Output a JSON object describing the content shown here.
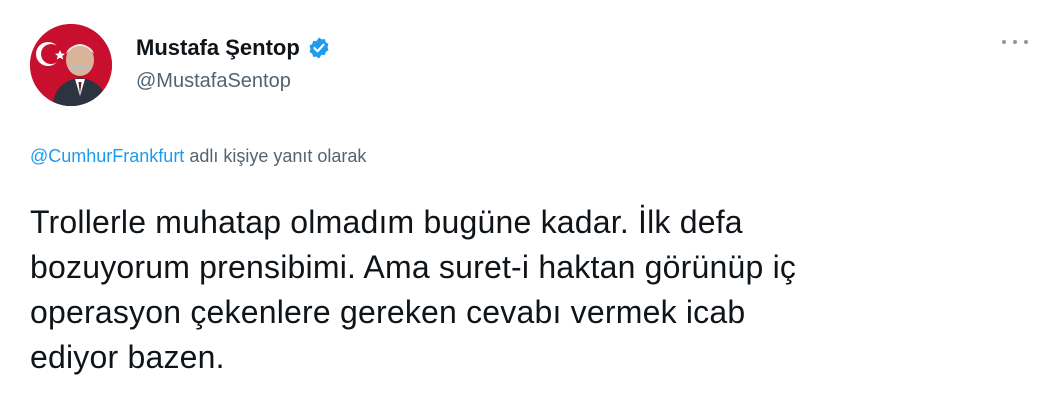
{
  "tweet": {
    "author": {
      "display_name": "Mustafa Şentop",
      "handle": "@MustafaSentop",
      "verified": true,
      "avatar_icon": "profile-avatar"
    },
    "reply": {
      "to_handle": "@CumhurFrankfurt",
      "suffix": " adlı kişiye yanıt olarak"
    },
    "text_lines": [
      "Trollerle muhatap olmadım bugüne kadar. İlk defa",
      "bozuyorum prensibimi. Ama suret-i haktan görünüp iç",
      "operasyon çekenlere gereken cevabı vermek icab",
      "ediyor bazen."
    ],
    "more_icon": "more-horizontal-icon"
  },
  "colors": {
    "accent": "#1d9bf0",
    "text_primary": "#0f1419",
    "text_secondary": "#536471",
    "flag_red": "#c8102e"
  }
}
